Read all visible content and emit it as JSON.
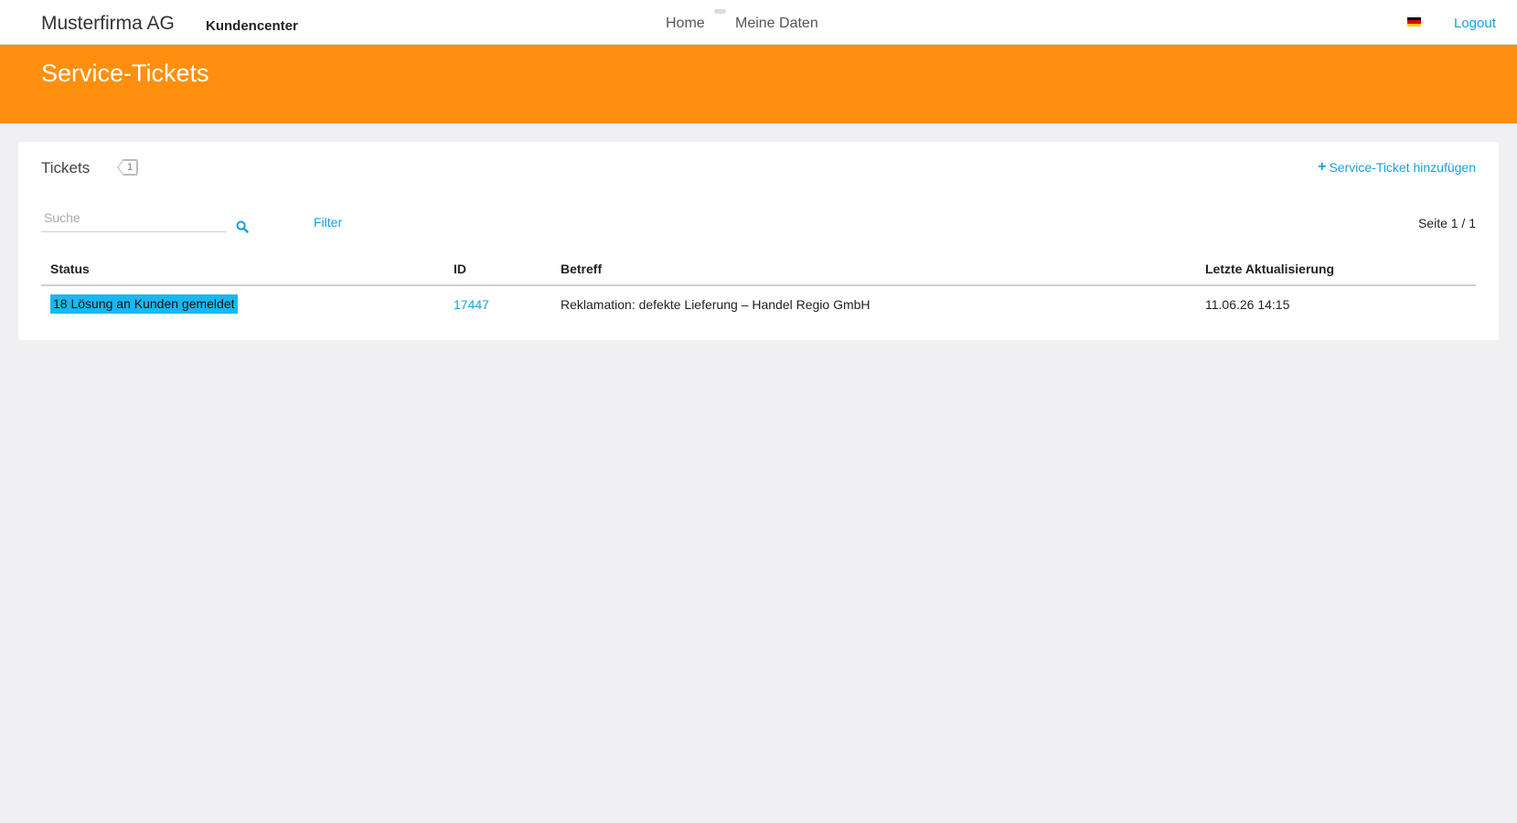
{
  "navbar": {
    "brand": "Musterfirma AG",
    "subbrand": "Kundencenter",
    "links": [
      {
        "label": "Home"
      },
      {
        "label": "Meine Daten"
      }
    ],
    "language_icon": "german-flag-icon",
    "logout": "Logout"
  },
  "header": {
    "title": "Service-Tickets",
    "color": "#ff8f0e"
  },
  "tickets": {
    "title": "Tickets",
    "count": "1",
    "add_label": "Service-Ticket hinzufügen",
    "search": {
      "placeholder": "Suche",
      "value": ""
    },
    "filter_label": "Filter",
    "pager": "Seite 1 / 1",
    "columns": [
      "Status",
      "ID",
      "Betreff",
      "Letzte Aktualisierung"
    ],
    "rows": [
      {
        "status": "18 Lösung an Kunden gemeldet",
        "id": "17447",
        "subject": "Reklamation: defekte Lieferung – Handel Regio GmbH",
        "updated": "11.06.26 14:15"
      }
    ]
  },
  "colors": {
    "accent": "#1a9fd8",
    "status_badge": "#17b8f0"
  }
}
